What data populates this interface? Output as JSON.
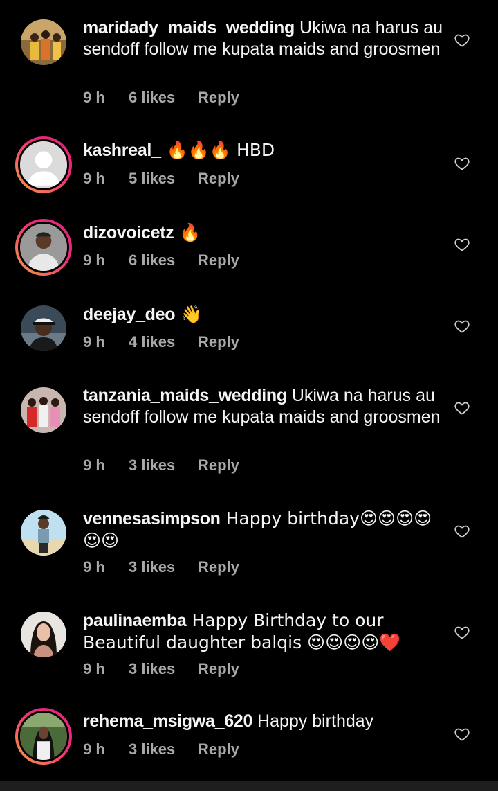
{
  "comments": [
    {
      "username": "maridady_maids_wedding",
      "text": " Ukiwa na harus au sendoff follow me kupata maids and groosmen",
      "time": "9 h",
      "likes": "6 likes",
      "reply": "Reply",
      "avatar": "wedding-party-photo"
    },
    {
      "username": "kashreal_",
      "text": " 🔥🔥🔥 HBD",
      "time": "9 h",
      "likes": "5 likes",
      "reply": "Reply",
      "avatar": "default-profile-placeholder"
    },
    {
      "username": "dizovoicetz",
      "text": " 🔥",
      "time": "9 h",
      "likes": "6 likes",
      "reply": "Reply",
      "avatar": "man-portrait"
    },
    {
      "username": "deejay_deo",
      "text": " 👋",
      "time": "9 h",
      "likes": "4 likes",
      "reply": "Reply",
      "avatar": "man-in-cap"
    },
    {
      "username": "tanzania_maids_wedding",
      "text": " Ukiwa na harus au sendoff follow me kupata maids and groosmen",
      "time": "9 h",
      "likes": "3 likes",
      "reply": "Reply",
      "avatar": "wedding-group-photo"
    },
    {
      "username": "vennesasimpson",
      "text": " Happy birthday😍😍😍😍😍😍",
      "time": "9 h",
      "likes": "3 likes",
      "reply": "Reply",
      "avatar": "woman-beach"
    },
    {
      "username": "paulinaemba",
      "text": " Happy Birthday to our Beautiful daughter balqis 😍😍😍😍❤️",
      "time": "9 h",
      "likes": "3 likes",
      "reply": "Reply",
      "avatar": "woman-portrait"
    },
    {
      "username": "rehema_msigwa_620",
      "text": " Happy birthday",
      "time": "9 h",
      "likes": "3 likes",
      "reply": "Reply",
      "avatar": "woman-outdoor"
    }
  ],
  "icons": {
    "like": "heart-outline-icon"
  },
  "colors": {
    "background": "#000000",
    "text": "#f5f5f5",
    "meta": "#a8a8a8",
    "story_ring": "#ee2a7b"
  }
}
